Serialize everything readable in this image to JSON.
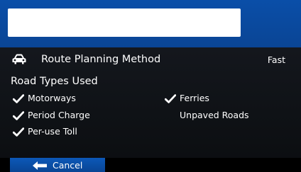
{
  "header": {
    "title_box": ""
  },
  "route": {
    "icon": "car-icon",
    "label": "Route Planning Method",
    "value": "Fast"
  },
  "road_types": {
    "title": "Road Types Used",
    "options": [
      {
        "label": "Motorways",
        "checked": true
      },
      {
        "label": "Period Charge",
        "checked": true
      },
      {
        "label": "Per-use Toll",
        "checked": true
      },
      {
        "label": "Ferries",
        "checked": true
      },
      {
        "label": "Unpaved Roads",
        "checked": false
      }
    ]
  },
  "footer": {
    "cancel_label": "Cancel",
    "cancel_icon": "back-arrow-icon"
  },
  "colors": {
    "header_blue": "#0a4ea8",
    "button_blue": "#0c58b8",
    "text": "#ffffff"
  }
}
